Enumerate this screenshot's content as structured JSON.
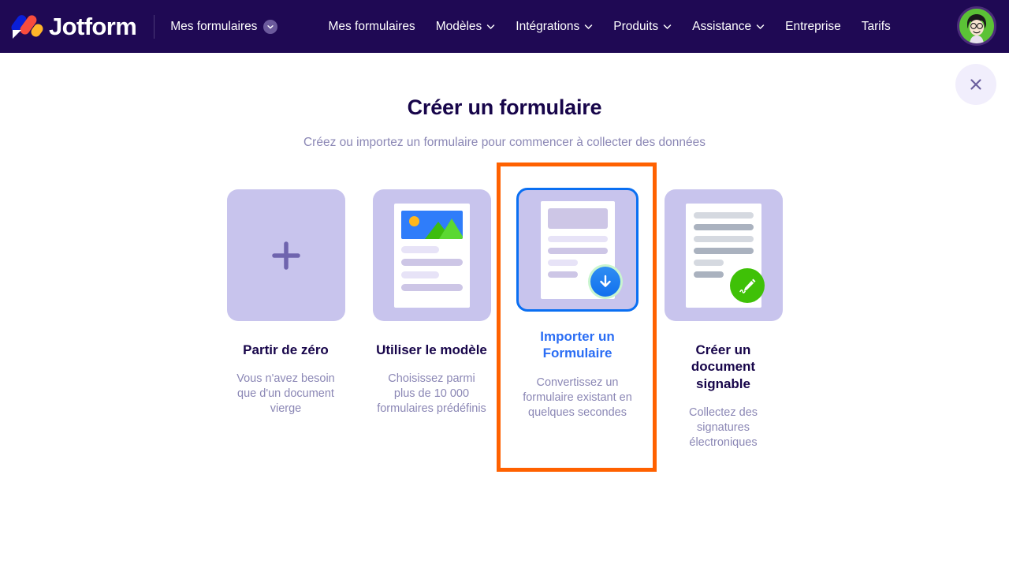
{
  "header": {
    "logo_text": "Jotform",
    "logo_icon": "jotform-logo-icon",
    "workspace_label": "Mes formulaires",
    "workspace_chevron_icon": "chevron-down-icon",
    "nav_items": [
      {
        "label": "Mes formulaires",
        "has_chevron": false
      },
      {
        "label": "Modèles",
        "has_chevron": true
      },
      {
        "label": "Intégrations",
        "has_chevron": true
      },
      {
        "label": "Produits",
        "has_chevron": true
      },
      {
        "label": "Assistance",
        "has_chevron": true
      },
      {
        "label": "Entreprise",
        "has_chevron": false
      },
      {
        "label": "Tarifs",
        "has_chevron": false
      }
    ],
    "avatar_icon": "user-avatar",
    "background_color": "#1f0954"
  },
  "close_button": {
    "icon": "close-icon",
    "label": "Fermer"
  },
  "main": {
    "title": "Créer un formulaire",
    "subtitle": "Créez ou importez un formulaire pour commencer à collecter des données",
    "cards": [
      {
        "id": "scratch",
        "title": "Partir de zéro",
        "description": "Vous n'avez besoin que d'un document vierge",
        "icon": "plus-icon",
        "selected": false
      },
      {
        "id": "template",
        "title": "Utiliser le modèle",
        "description": "Choisissez parmi plus de 10 000 formulaires prédéfinis",
        "icon": "document-with-image-icon",
        "selected": false
      },
      {
        "id": "import",
        "title": "Importer un Formulaire",
        "description": "Convertissez un formulaire existant en quelques secondes",
        "icon": "document-download-icon",
        "selected": true
      },
      {
        "id": "sign",
        "title": "Créer un document signable",
        "description": "Collectez des signatures électroniques",
        "icon": "document-sign-icon",
        "selected": false
      }
    ]
  },
  "highlight": {
    "target": "import",
    "color": "#ff6100"
  },
  "colors": {
    "header_bg": "#1f0954",
    "title": "#17054a",
    "muted_text": "#8b87b5",
    "accent_blue": "#2a6df4",
    "thumb_bg": "#c8c4ed",
    "highlight_orange": "#ff6100",
    "green_badge": "#3fc107"
  }
}
